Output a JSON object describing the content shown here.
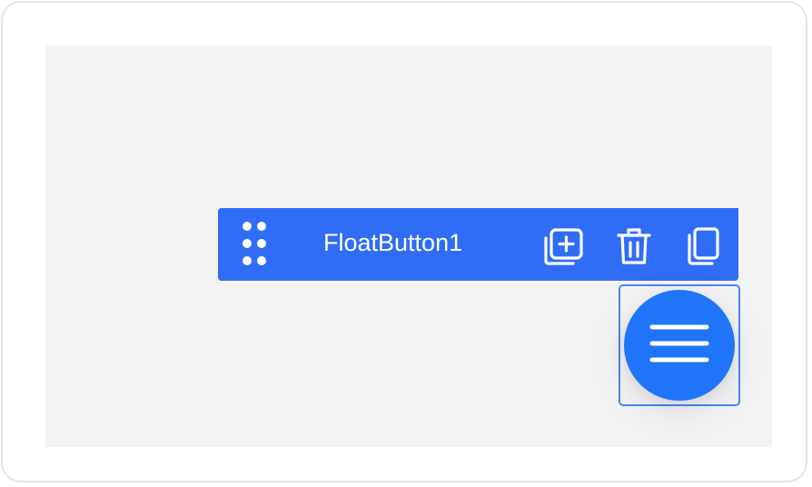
{
  "component": {
    "name": "FloatButton1"
  },
  "toolbar": {
    "actions": [
      {
        "icon": "add-copy-icon"
      },
      {
        "icon": "trash-icon"
      },
      {
        "icon": "duplicate-icon"
      }
    ]
  },
  "fab": {
    "icon": "menu-icon"
  },
  "colors": {
    "toolbar_bg": "#2f6df6",
    "fab_bg": "#1f74fa",
    "selection_border": "#4a86f2",
    "canvas_bg": "#f3f3f3"
  }
}
